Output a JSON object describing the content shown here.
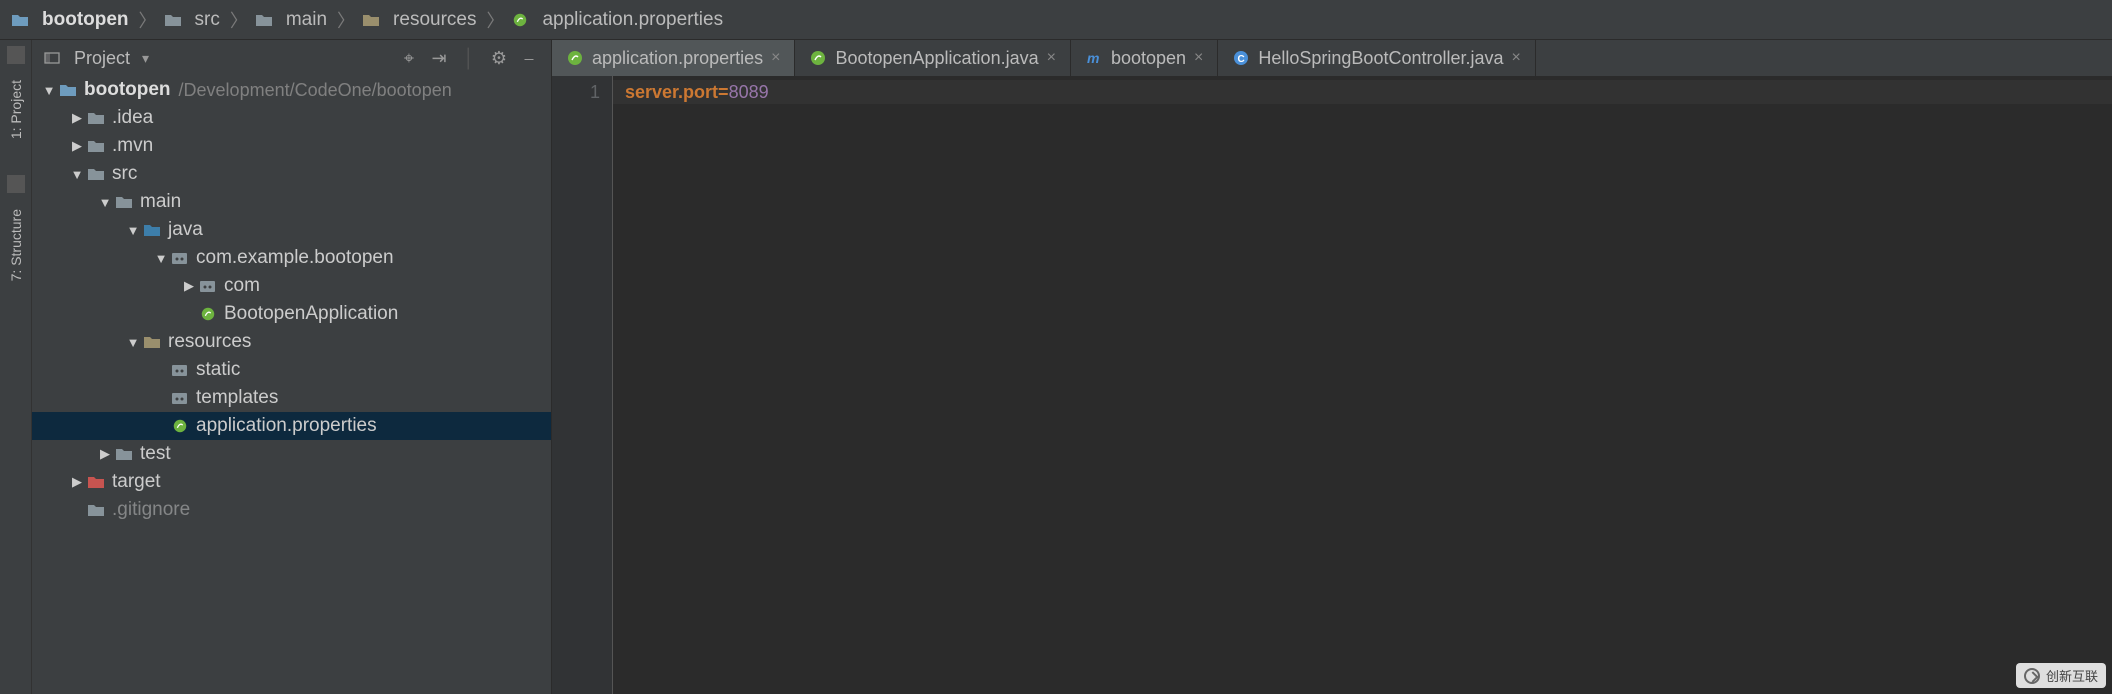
{
  "breadcrumb": [
    {
      "icon": "module",
      "label": "bootopen",
      "bold": true
    },
    {
      "icon": "folder",
      "label": "src"
    },
    {
      "icon": "folder",
      "label": "main"
    },
    {
      "icon": "resources",
      "label": "resources"
    },
    {
      "icon": "spring",
      "label": "application.properties"
    }
  ],
  "left_rail": {
    "project_label": "1: Project",
    "structure_label": "7: Structure"
  },
  "project_panel": {
    "title": "Project",
    "toolbar_icons": [
      "target-icon",
      "collapse-icon",
      "divider",
      "gear-icon",
      "hide-icon"
    ]
  },
  "tree": [
    {
      "depth": 0,
      "arrow": "down",
      "icon": "module",
      "label": "bootopen",
      "bold": true,
      "hint": "/Development/CodeOne/bootopen"
    },
    {
      "depth": 1,
      "arrow": "right",
      "icon": "folder",
      "label": ".idea"
    },
    {
      "depth": 1,
      "arrow": "right",
      "icon": "folder",
      "label": ".mvn"
    },
    {
      "depth": 1,
      "arrow": "down",
      "icon": "folder",
      "label": "src"
    },
    {
      "depth": 2,
      "arrow": "down",
      "icon": "folder",
      "label": "main"
    },
    {
      "depth": 3,
      "arrow": "down",
      "icon": "source",
      "label": "java"
    },
    {
      "depth": 4,
      "arrow": "down",
      "icon": "package",
      "label": "com.example.bootopen"
    },
    {
      "depth": 5,
      "arrow": "right",
      "icon": "package",
      "label": "com"
    },
    {
      "depth": 5,
      "arrow": "",
      "icon": "springclass",
      "label": "BootopenApplication"
    },
    {
      "depth": 3,
      "arrow": "down",
      "icon": "resources",
      "label": "resources"
    },
    {
      "depth": 4,
      "arrow": "",
      "icon": "package",
      "label": "static"
    },
    {
      "depth": 4,
      "arrow": "",
      "icon": "package",
      "label": "templates"
    },
    {
      "depth": 4,
      "arrow": "",
      "icon": "spring",
      "label": "application.properties",
      "selected": true
    },
    {
      "depth": 2,
      "arrow": "right",
      "icon": "folder",
      "label": "test"
    },
    {
      "depth": 1,
      "arrow": "right",
      "icon": "excluded",
      "label": "target"
    },
    {
      "depth": 1,
      "arrow": "",
      "icon": "file",
      "label": ".gitignore",
      "cut": true
    }
  ],
  "tabs": [
    {
      "icon": "spring",
      "label": "application.properties",
      "active": true,
      "closeable": true
    },
    {
      "icon": "springclass",
      "label": "BootopenApplication.java",
      "closeable": true
    },
    {
      "icon": "maven",
      "label": "bootopen",
      "closeable": true
    },
    {
      "icon": "javaclass",
      "label": "HelloSpringBootController.java",
      "closeable": true
    }
  ],
  "editor": {
    "lines": [
      {
        "n": 1,
        "key": "server.port=",
        "val": "8089"
      }
    ]
  },
  "watermark": "创新互联"
}
